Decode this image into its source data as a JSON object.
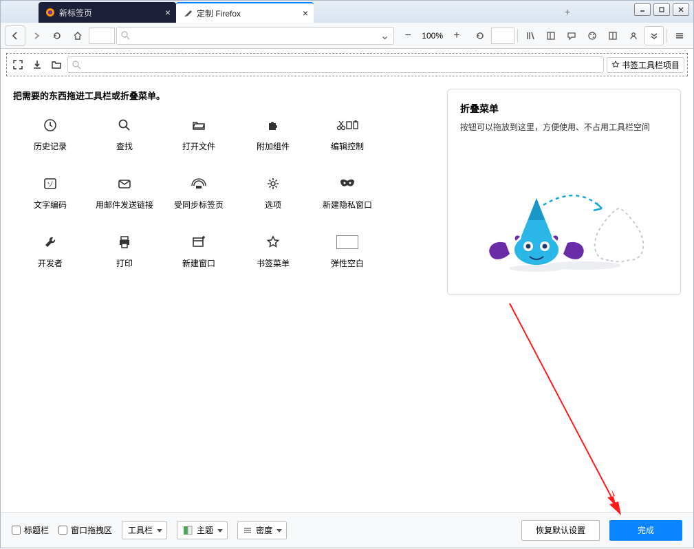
{
  "tabs": [
    {
      "label": "新标签页",
      "active": false
    },
    {
      "label": "定制 Firefox",
      "active": true
    }
  ],
  "zoom": {
    "level": "100%"
  },
  "bookmarks_toolbar_item": "书签工具栏项目",
  "palette_title": "把需要的东西拖进工具栏或折叠菜单。",
  "palette": [
    {
      "id": "history",
      "label": "历史记录"
    },
    {
      "id": "find",
      "label": "查找"
    },
    {
      "id": "openfile",
      "label": "打开文件"
    },
    {
      "id": "addons",
      "label": "附加组件"
    },
    {
      "id": "editctl",
      "label": "编辑控制"
    },
    {
      "id": "encoding",
      "label": "文字编码"
    },
    {
      "id": "emaillink",
      "label": "用邮件发送链接"
    },
    {
      "id": "synced-tabs",
      "label": "受同步标签页"
    },
    {
      "id": "preferences",
      "label": "选项"
    },
    {
      "id": "private",
      "label": "新建隐私窗口"
    },
    {
      "id": "developer",
      "label": "开发者"
    },
    {
      "id": "print",
      "label": "打印"
    },
    {
      "id": "newwindow",
      "label": "新建窗口"
    },
    {
      "id": "bookmarks-menu",
      "label": "书签菜单"
    },
    {
      "id": "flexspace",
      "label": "弹性空白"
    }
  ],
  "overflow": {
    "title": "折叠菜单",
    "desc": "按钮可以拖放到这里，方便使用、不占用工具栏空间"
  },
  "bottom": {
    "titlebar_chk": "标题栏",
    "dragarea_chk": "窗口拖拽区",
    "toolbars_dd": "工具栏",
    "themes_dd": "主题",
    "density_dd": "密度",
    "restore": "恢复默认设置",
    "done": "完成"
  }
}
